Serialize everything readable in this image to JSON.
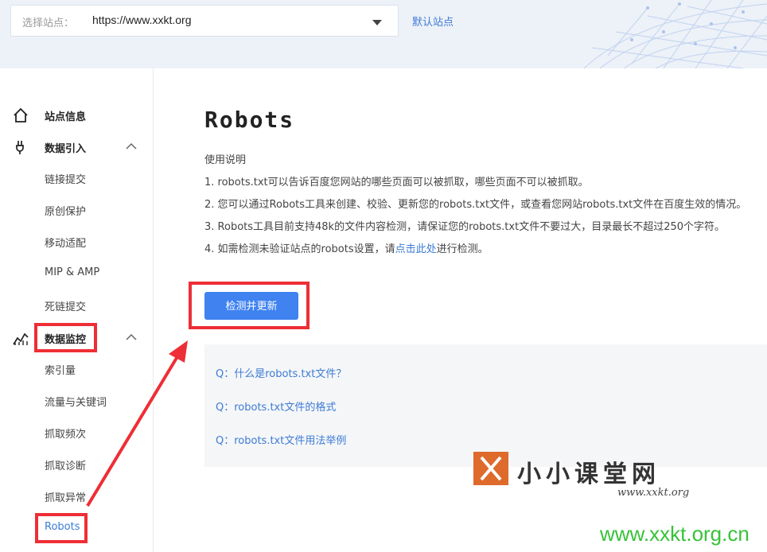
{
  "topbar": {
    "select_label": "选择站点：",
    "select_value": "https://www.xxkt.org",
    "default_site": "默认站点"
  },
  "sidebar": {
    "site_info": "站点信息",
    "data_import": {
      "label": "数据引入",
      "items": [
        "链接提交",
        "原创保护",
        "移动适配",
        "MIP & AMP",
        "死链提交"
      ]
    },
    "data_monitor": {
      "label": "数据监控",
      "items": [
        "索引量",
        "流量与关键词",
        "抓取频次",
        "抓取诊断",
        "抓取异常",
        "Robots"
      ]
    }
  },
  "main": {
    "title": "Robots",
    "usage_heading": "使用说明",
    "usage_lines": [
      "1. robots.txt可以告诉百度您网站的哪些页面可以被抓取，哪些页面不可以被抓取。",
      "2. 您可以通过Robots工具来创建、校验、更新您的robots.txt文件，或查看您网站robots.txt文件在百度生效的情况。",
      "3. Robots工具目前支持48k的文件内容检测，请保证您的robots.txt文件不要过大，目录最长不超过250个字符。"
    ],
    "usage_line4_prefix": "4. 如需检测未验证站点的robots设置，请",
    "usage_line4_link": "点击此处",
    "usage_line4_suffix": "进行检测。",
    "check_button": "检测并更新",
    "faq": [
      "Q：什么是robots.txt文件？",
      "Q：robots.txt文件的格式",
      "Q：robots.txt文件用法举例"
    ]
  },
  "watermark": {
    "title": "小小课堂网",
    "subtitle": "www.xxkt.org",
    "url": "www.xxkt.org.cn"
  },
  "colors": {
    "accent": "#3f82f0",
    "link": "#3c7bd6",
    "highlight": "#ee2e36",
    "watermark_green": "#37c23a"
  }
}
